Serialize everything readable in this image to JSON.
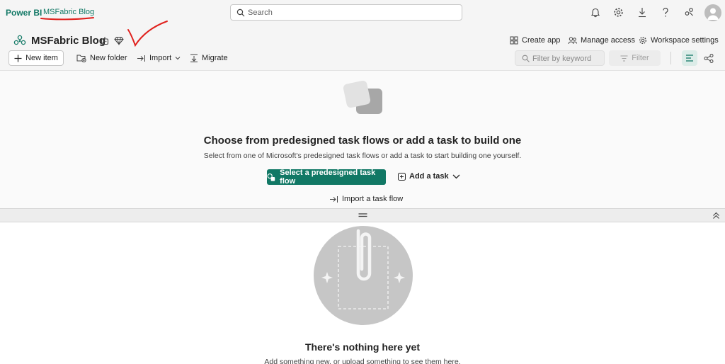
{
  "topbar": {
    "brand": "Power BI",
    "breadcrumb": "MSFabric Blog",
    "search_placeholder": "Search",
    "icons": [
      "bell-icon",
      "gear-icon",
      "download-icon",
      "help-icon",
      "share-icon",
      "avatar"
    ]
  },
  "workspace": {
    "title": "MSFabric Blog",
    "actions": {
      "create_app": "Create app",
      "manage_access": "Manage access",
      "workspace_settings": "Workspace settings"
    }
  },
  "toolbar": {
    "new_item": "New item",
    "new_folder": "New folder",
    "import": "Import",
    "migrate": "Migrate",
    "filter_placeholder": "Filter by keyword",
    "filter": "Filter"
  },
  "taskflow": {
    "heading": "Choose from predesigned task flows or add a task to build one",
    "subtext": "Select from one of Microsoft's predesigned task flows or add a task to start building one yourself.",
    "primary_button": "Select a predesigned task flow",
    "add_task": "Add a task",
    "import_flow": "Import a task flow"
  },
  "empty_state": {
    "title": "There's nothing here yet",
    "subtext": "Add something new, or upload something to see them here."
  },
  "colors": {
    "accent": "#117865",
    "annotation": "#e0201c"
  }
}
